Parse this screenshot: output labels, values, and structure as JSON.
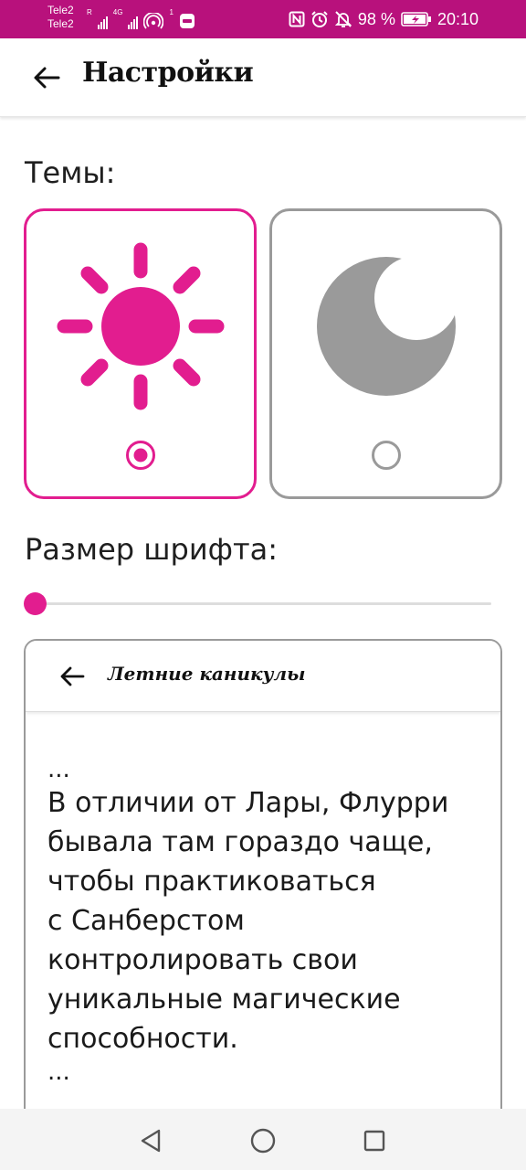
{
  "status_bar": {
    "carrier_1": "Tele2",
    "carrier_2": "Tele2",
    "network_type": "4G",
    "small_label": "R",
    "hotspot_badge": "1",
    "battery_percent": "98 %",
    "time": "20:10",
    "background_color": "#b8117c",
    "icons": [
      "signal-icon",
      "signal-4g-icon",
      "hotspot-icon",
      "app-notification-icon",
      "nfc-icon",
      "alarm-icon",
      "silent-icon",
      "battery-icon"
    ]
  },
  "app_bar": {
    "title": "Настройки",
    "back_icon": "arrow-left-icon"
  },
  "themes": {
    "label": "Темы:",
    "options": [
      {
        "name": "light",
        "icon": "sun-icon",
        "selected": true,
        "color": "#e21d8f"
      },
      {
        "name": "dark",
        "icon": "moon-icon",
        "selected": false,
        "color": "#9a9a9a"
      }
    ]
  },
  "font_size": {
    "label": "Размер шрифта:",
    "slider_value": 0.0,
    "accent_color": "#e21d8f"
  },
  "preview": {
    "title": "Летние каникулы",
    "back_icon": "arrow-left-icon",
    "ellipsis_top": "...",
    "lines": [
      "В отличии от Лары, Флурри",
      "бывала там гораздо чаще,",
      "чтобы практиковаться",
      "с Санберстом",
      "контролировать свои",
      "уникальные магические",
      "способности."
    ],
    "ellipsis_bottom": "..."
  },
  "nav_bar": {
    "buttons": [
      "back-triangle-icon",
      "home-circle-icon",
      "recents-square-icon"
    ]
  }
}
